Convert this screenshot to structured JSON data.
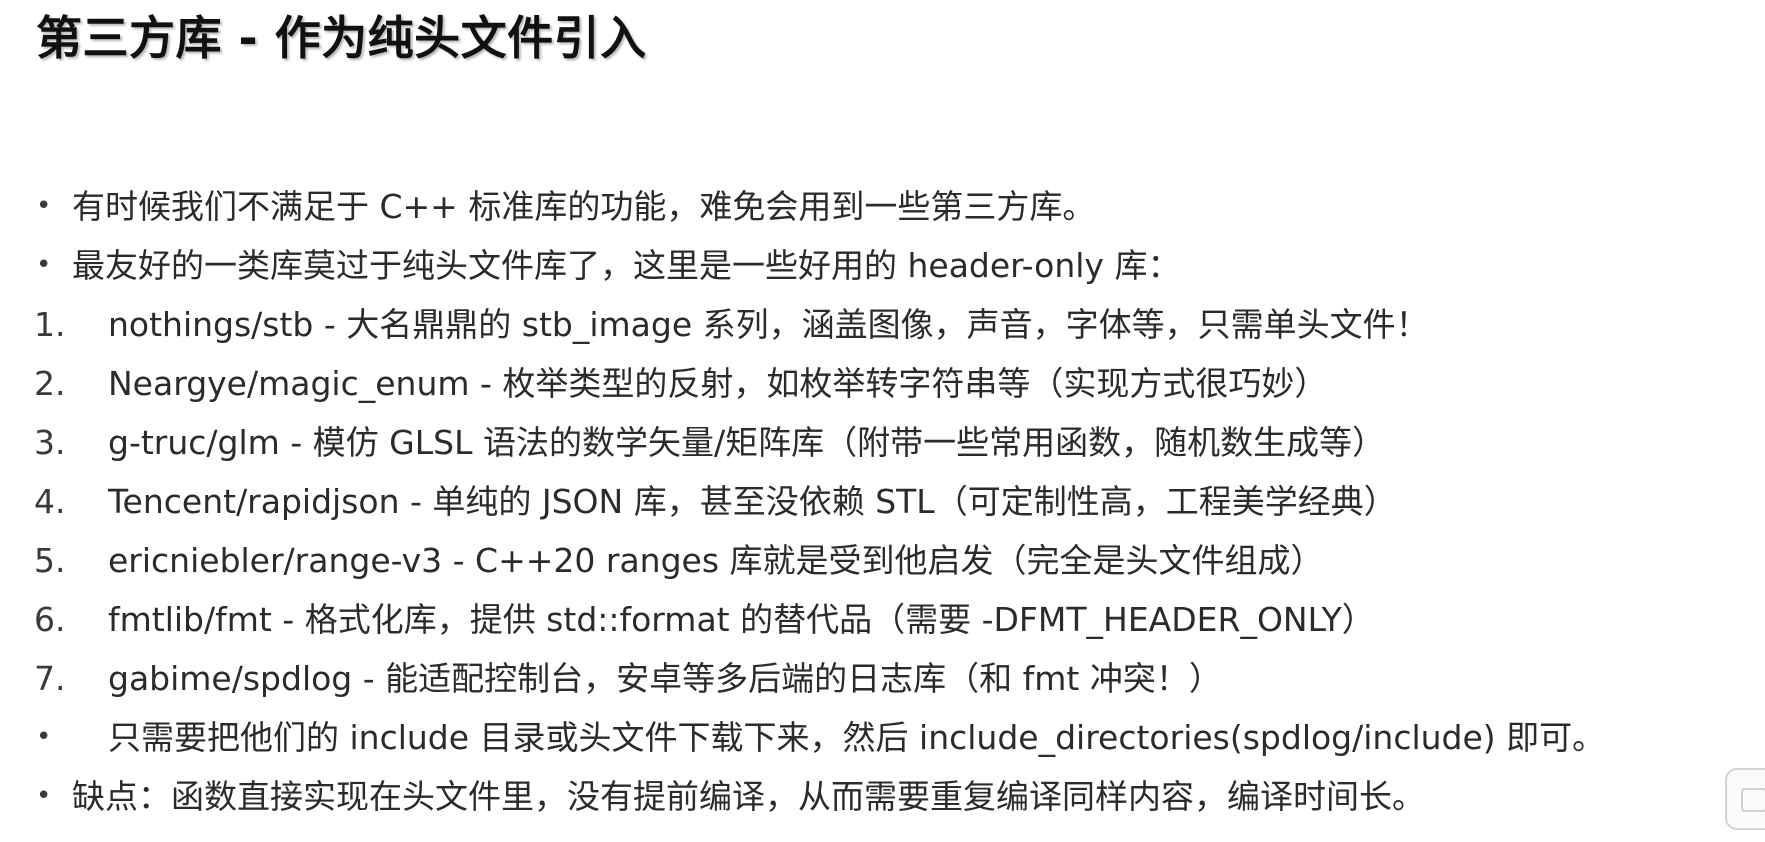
{
  "slide": {
    "title": "第三方库 - 作为纯头文件引入",
    "items": [
      {
        "marker": "•",
        "style": "bullet",
        "text": "有时候我们不满足于 C++ 标准库的功能，难免会用到一些第三方库。"
      },
      {
        "marker": "•",
        "style": "bullet",
        "text": "最友好的一类库莫过于纯头文件库了，这里是一些好用的 header-only 库："
      },
      {
        "marker": "1.",
        "style": "numbered",
        "text": "nothings/stb - 大名鼎鼎的 stb_image 系列，涵盖图像，声音，字体等，只需单头文件！"
      },
      {
        "marker": "2.",
        "style": "numbered",
        "text": "Neargye/magic_enum - 枚举类型的反射，如枚举转字符串等（实现方式很巧妙）"
      },
      {
        "marker": "3.",
        "style": "numbered",
        "text": "g-truc/glm - 模仿 GLSL 语法的数学矢量/矩阵库（附带一些常用函数，随机数生成等）"
      },
      {
        "marker": "4.",
        "style": "numbered",
        "text": "Tencent/rapidjson - 单纯的 JSON 库，甚至没依赖 STL（可定制性高，工程美学经典）"
      },
      {
        "marker": "5.",
        "style": "numbered",
        "text": "ericniebler/range-v3 - C++20 ranges 库就是受到他启发（完全是头文件组成）"
      },
      {
        "marker": "6.",
        "style": "numbered",
        "text": "fmtlib/fmt - 格式化库，提供 std::format 的替代品（需要 -DFMT_HEADER_ONLY）"
      },
      {
        "marker": "7.",
        "style": "numbered",
        "text": "gabime/spdlog - 能适配控制台，安卓等多后端的日志库（和 fmt 冲突！）"
      },
      {
        "marker": "•",
        "style": "numbered",
        "text": "只需要把他们的 include 目录或头文件下载下来，然后 include_directories(spdlog/include) 即可。"
      },
      {
        "marker": "•",
        "style": "bullet",
        "text": "缺点：函数直接实现在头文件里，没有提前编译，从而需要重复编译同样内容，编译时间长。"
      }
    ]
  }
}
